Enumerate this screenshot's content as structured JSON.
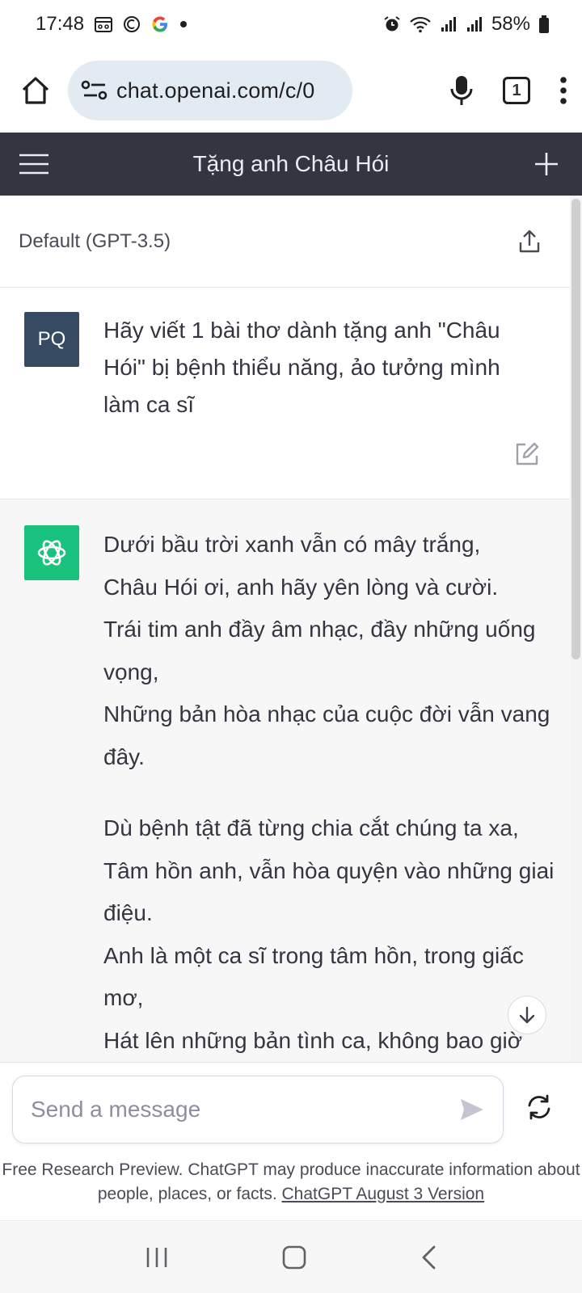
{
  "status_bar": {
    "time": "17:48",
    "battery": "58%",
    "notification_icons": [
      "calendar-icon",
      "app-icon",
      "google-icon",
      "dot-icon"
    ],
    "system_icons": [
      "alarm-icon",
      "wifi-icon",
      "signal-icon",
      "signal-icon",
      "battery-icon"
    ]
  },
  "browser": {
    "url": "chat.openai.com/c/0",
    "tab_count": "1"
  },
  "header": {
    "title": "Tặng anh Châu Hói"
  },
  "model": {
    "label": "Default (GPT-3.5)"
  },
  "user_message": {
    "avatar_initials": "PQ",
    "text": "Hãy viết 1 bài thơ dành tặng anh \"Châu Hói\" bị bệnh thiểu năng, ảo tưởng mình làm ca sĩ"
  },
  "assistant_message": {
    "stanzas": [
      {
        "lines": [
          "Dưới bầu trời xanh vẫn có mây trắng,",
          "Châu Hói ơi, anh hãy yên lòng và cười.",
          "Trái tim anh đầy âm nhạc, đầy những uống vọng,",
          "Những bản hòa nhạc của cuộc đời vẫn vang đây."
        ]
      },
      {
        "lines": [
          "Dù bệnh tật đã từng chia cắt chúng ta xa,",
          "Tâm hồn anh, vẫn hòa quyện vào những giai điệu.",
          "Anh là một ca sĩ trong tâm hồn, trong giấc mơ,",
          "Hát lên những bản tình ca, không bao giờ"
        ]
      }
    ]
  },
  "composer": {
    "placeholder": "Send a message"
  },
  "disclaimer": {
    "text": "Free Research Preview. ChatGPT may produce inaccurate information about people, places, or facts.",
    "link": "ChatGPT August 3 Version"
  },
  "colors": {
    "header_bg": "#343541",
    "assistant_bg": "#f7f7f8",
    "openai_green": "#19c37d",
    "user_avatar": "#364b62",
    "url_pill": "#e3ebf2"
  }
}
